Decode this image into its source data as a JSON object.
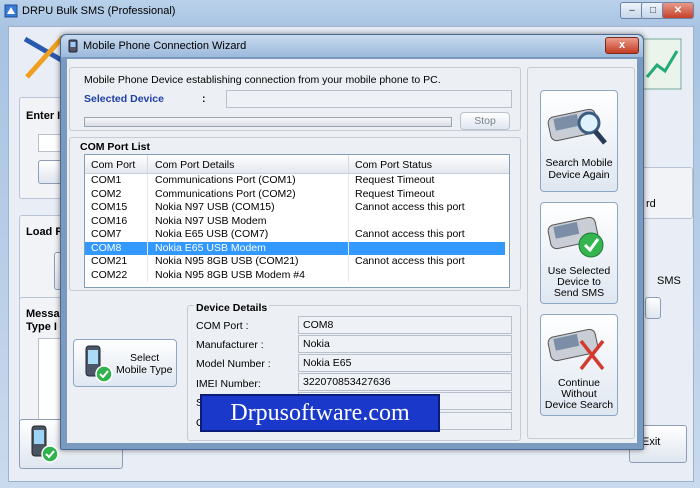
{
  "main_window": {
    "title": "DRPU Bulk SMS (Professional)",
    "enter_label": "Enter I",
    "load_label": "Load R",
    "message_label": "Messa",
    "type_label": "Type I",
    "sms_label": "SMS",
    "exit_label": "Exit",
    "board_label": "rd"
  },
  "dialog": {
    "title": "Mobile Phone Connection Wizard",
    "close_label": "x",
    "intro_text": "Mobile Phone Device establishing connection from your mobile phone to PC.",
    "selected_device_label": "Selected Device",
    "selected_device_colon": ":",
    "selected_device_value": "",
    "stop_label": "Stop",
    "progress": 0.0,
    "com_port_list": {
      "title": "COM Port List",
      "headers": [
        "Com Port",
        "Com Port Details",
        "Com Port Status"
      ],
      "rows": [
        {
          "port": "COM1",
          "details": "Communications Port (COM1)",
          "status": "Request Timeout"
        },
        {
          "port": "COM2",
          "details": "Communications Port (COM2)",
          "status": "Request Timeout"
        },
        {
          "port": "COM15",
          "details": "Nokia N97 USB (COM15)",
          "status": "Cannot access this port"
        },
        {
          "port": "COM16",
          "details": "Nokia N97 USB Modem",
          "status": ""
        },
        {
          "port": "COM7",
          "details": "Nokia E65 USB (COM7)",
          "status": "Cannot access this port"
        },
        {
          "port": "COM8",
          "details": "Nokia E65 USB Modem",
          "status": ""
        },
        {
          "port": "COM21",
          "details": "Nokia N95 8GB USB (COM21)",
          "status": "Cannot access this port"
        },
        {
          "port": "COM22",
          "details": "Nokia N95 8GB USB Modem #4",
          "status": ""
        }
      ],
      "selected_index": 5
    },
    "select_mobile_type": {
      "line1": "Select",
      "line2": "Mobile Type"
    },
    "device_details": {
      "title": "Device Details",
      "com_port_label": "COM Port :",
      "com_port_value": "COM8",
      "manufacturer_label": "Manufacturer :",
      "manufacturer_value": "Nokia",
      "model_label": "Model Number :",
      "model_value": "Nokia E65",
      "imei_label": "IMEI Number:",
      "imei_value": "322070853427636",
      "row5_label": "S",
      "row6_label": "O"
    },
    "side_buttons": {
      "search": {
        "line1": "Search Mobile",
        "line2": "Device Again"
      },
      "use_selected": {
        "line1": "Use Selected",
        "line2": "Device to",
        "line3": "Send SMS"
      },
      "continue": {
        "line1": "Continue",
        "line2": "Without",
        "line3": "Device Search"
      }
    }
  },
  "watermark": "Drpusoftware.com",
  "colors": {
    "selection": "#3399ff",
    "header_blue": "#1f3fa8",
    "watermark_bg": "#1a38c9"
  }
}
